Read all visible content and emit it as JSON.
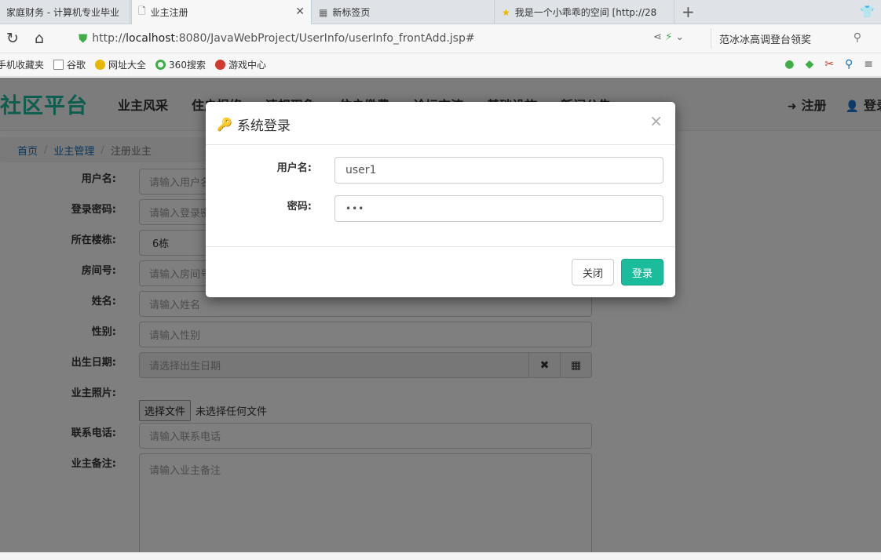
{
  "browser": {
    "tabs": [
      {
        "label": "家庭财务 - 计算机专业毕业",
        "active": false
      },
      {
        "label": "业主注册",
        "active": true
      },
      {
        "label": "新标签页",
        "active": false
      },
      {
        "label": "我是一个小乖乖的空间 [http://28",
        "active": false
      }
    ],
    "url_prefix": "http://",
    "url_host": "localhost",
    "url_rest": ":8080/JavaWebProject/UserInfo/userInfo_frontAdd.jsp#",
    "search_text": "范冰冰高调登台领奖",
    "bookmarks": [
      "手机收藏夹",
      "谷歌",
      "网址大全",
      "360搜索",
      "游戏中心"
    ]
  },
  "site": {
    "brand": "社区平台",
    "menu": [
      "业主风采",
      "住户报修",
      "违规现象",
      "住户缴费",
      "论坛交流",
      "基础设施",
      "新闻公告"
    ],
    "register": "注册",
    "login": "登录"
  },
  "breadcrumb": [
    "首页",
    "业主管理",
    "注册业主"
  ],
  "form": {
    "username": {
      "label": "用户名:",
      "placeholder": "请输入用户名"
    },
    "password": {
      "label": "登录密码:",
      "placeholder": "请输入登录密码"
    },
    "building": {
      "label": "所在楼栋:",
      "value": "6栋"
    },
    "room": {
      "label": "房间号:",
      "placeholder": "请输入房间号"
    },
    "name": {
      "label": "姓名:",
      "placeholder": "请输入姓名"
    },
    "gender": {
      "label": "性别:",
      "placeholder": "请输入性别"
    },
    "birthday": {
      "label": "出生日期:",
      "placeholder": "请选择出生日期"
    },
    "photo": {
      "label": "业主照片:",
      "button": "选择文件",
      "status": "未选择任何文件"
    },
    "phone": {
      "label": "联系电话:",
      "placeholder": "请输入联系电话"
    },
    "memo": {
      "label": "业主备注:",
      "placeholder": "请输入业主备注"
    }
  },
  "modal": {
    "title": "系统登录",
    "close_x": "×",
    "username_label": "用户名:",
    "username_value": "user1",
    "password_label": "密码:",
    "password_value": "•••",
    "close_button": "关闭",
    "login_button": "登录"
  },
  "colors": {
    "accent": "#1abc9c",
    "link": "#1a6fb5"
  }
}
